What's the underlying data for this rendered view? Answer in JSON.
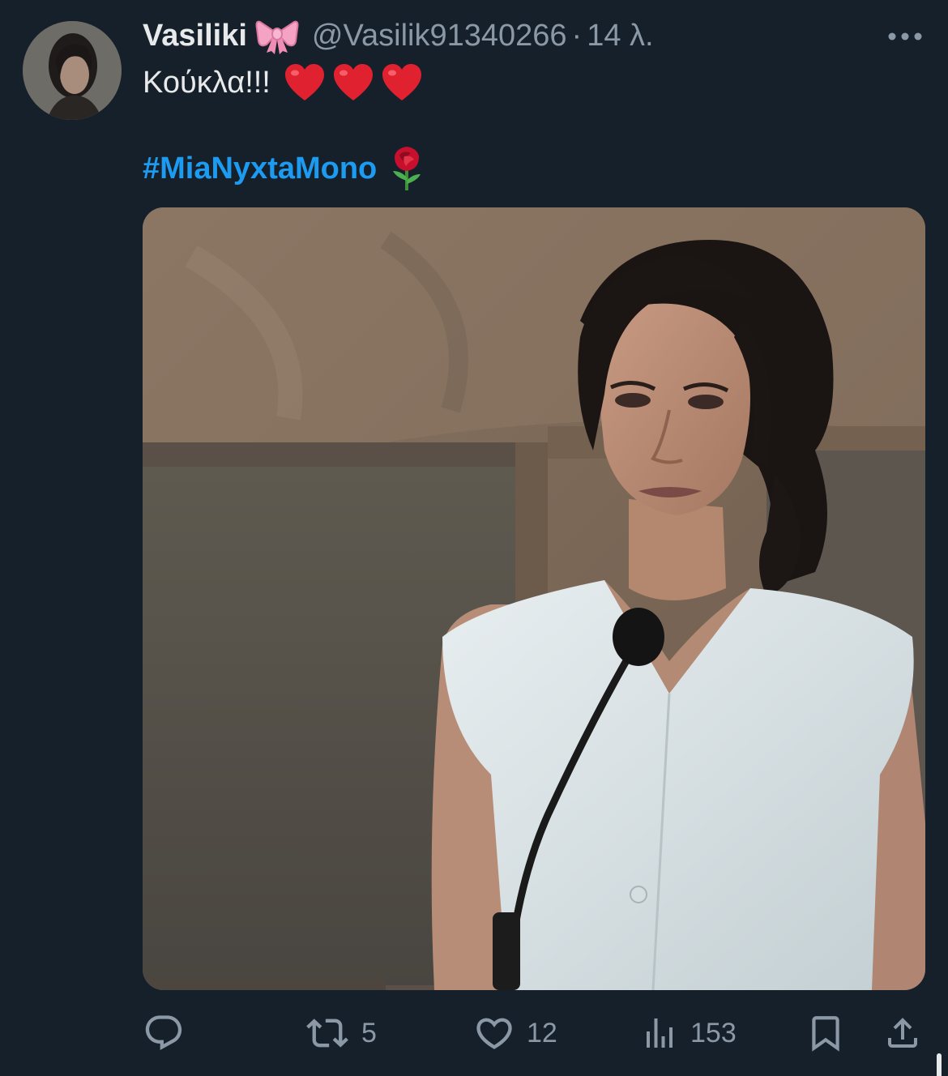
{
  "tweet": {
    "author": {
      "name": "Vasiliki",
      "name_emoji": "ribbon-bow-emoji",
      "handle": "@Vasilik91340266",
      "separator": "·",
      "time": "14 λ."
    },
    "text": "Κούκλα!!!",
    "text_emojis": [
      "red-heart-emoji",
      "red-heart-emoji",
      "red-heart-emoji"
    ],
    "hashtag": "#MiaNyxtaMono",
    "hashtag_emoji": "rose-emoji",
    "media": {
      "type": "photo",
      "description_icon": "photo"
    },
    "actions": {
      "reply": {
        "icon": "reply-icon",
        "count": ""
      },
      "retweet": {
        "icon": "retweet-icon",
        "count": "5"
      },
      "like": {
        "icon": "heart-icon",
        "count": "12"
      },
      "views": {
        "icon": "views-bar-chart-icon",
        "count": "153"
      },
      "bookmark": {
        "icon": "bookmark-icon"
      },
      "share": {
        "icon": "share-icon"
      }
    }
  },
  "colors": {
    "background": "#15202b",
    "text_primary": "#e7e9ea",
    "text_secondary": "#8b98a5",
    "hashtag": "#1d9bf0",
    "heart_emoji": "#e0212f",
    "bow_emoji": "#f4a3c4"
  }
}
